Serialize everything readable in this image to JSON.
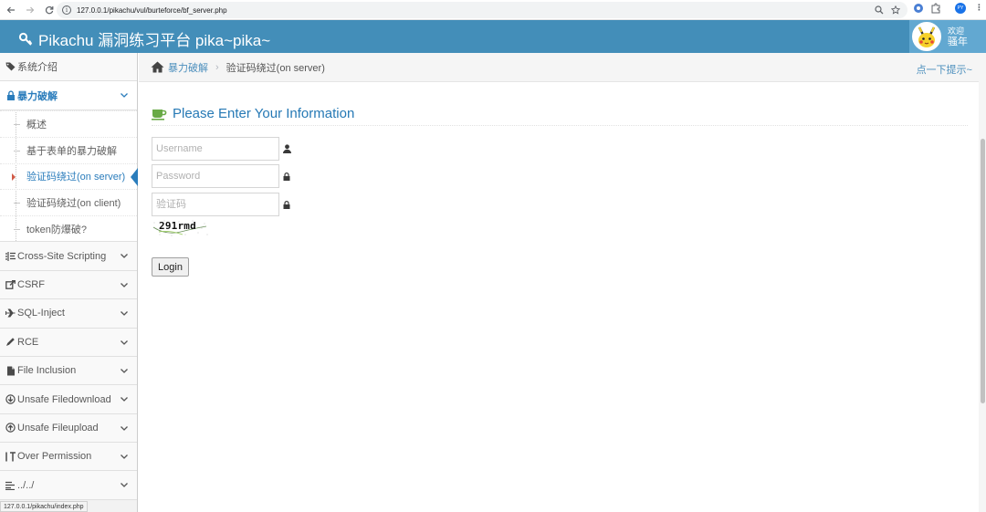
{
  "browser": {
    "url": "127.0.0.1/pikachu/vul/burteforce/bf_server.php",
    "profile_badge": "PY",
    "status_url": "127.0.0.1/pikachu/index.php"
  },
  "header": {
    "title": "Pikachu 漏洞练习平台 pika~pika~",
    "greeting": "欢迎",
    "username": "骚年"
  },
  "sidebar": {
    "items": [
      {
        "label": "系统介绍",
        "icon": "tag-icon"
      },
      {
        "label": "暴力破解",
        "icon": "lock-icon",
        "open": true
      },
      {
        "label": "Cross-Site Scripting",
        "icon": "list-icon"
      },
      {
        "label": "CSRF",
        "icon": "share-icon"
      },
      {
        "label": "SQL-Inject",
        "icon": "plane-icon"
      },
      {
        "label": "RCE",
        "icon": "pencil-icon"
      },
      {
        "label": "File Inclusion",
        "icon": "file-icon"
      },
      {
        "label": "Unsafe Filedownload",
        "icon": "download-circle-icon"
      },
      {
        "label": "Unsafe Fileupload",
        "icon": "upload-circle-icon"
      },
      {
        "label": "Over Permission",
        "icon": "text-cursor-icon"
      },
      {
        "label": "../../",
        "icon": "align-left-icon"
      }
    ],
    "submenu": [
      {
        "label": "概述"
      },
      {
        "label": "基于表单的暴力破解"
      },
      {
        "label": "验证码绕过(on server)",
        "active": true
      },
      {
        "label": "验证码绕过(on client)"
      },
      {
        "label": "token防爆破?"
      }
    ]
  },
  "breadcrumb": {
    "parent": "暴力破解",
    "separator": "›",
    "current": "验证码绕过(on server)",
    "hint": "点一下提示~"
  },
  "form": {
    "title": "Please Enter Your Information",
    "username_placeholder": "Username",
    "password_placeholder": "Password",
    "captcha_placeholder": "验证码",
    "captcha_text": "291rmd",
    "login_label": "Login"
  },
  "colors": {
    "header_bg": "#438eb9",
    "accent": "#2b7dbc",
    "title": "#2679b5",
    "cup_icon": "#69aa46"
  }
}
